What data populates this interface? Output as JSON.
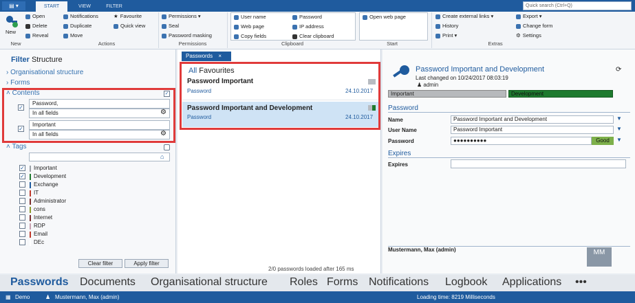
{
  "app": {
    "menu_label": "▤ ▾",
    "tabs": [
      "START",
      "VIEW",
      "FILTER"
    ],
    "search_placeholder": "Quick search (Ctrl+Q)"
  },
  "ribbon": {
    "new_label": "New",
    "new_items": [
      "Open",
      "Delete",
      "Reveal"
    ],
    "actions_items": [
      "Notifications",
      "Duplicate",
      "Move",
      "Favourite",
      "Quick view"
    ],
    "permissions_items": [
      "Permissions ▾",
      "Seal",
      "Password masking"
    ],
    "clipboard_items": [
      "User name",
      "Web page",
      "Copy fields",
      "Password",
      "IP address",
      "Clear clipboard"
    ],
    "start_items": [
      "Open web page"
    ],
    "extras_items": [
      "Create external links ▾",
      "History",
      "Print ▾",
      "Export ▾",
      "Change form",
      "Settings"
    ],
    "groups": [
      "New",
      "Actions",
      "Permissions",
      "Clipboard",
      "Start",
      "Extras"
    ]
  },
  "filter": {
    "title_bold": "Filter",
    "title_rest": "Structure",
    "sections": [
      "Organisational structure",
      "Forms",
      "Contents",
      "Tags"
    ],
    "content_filters": [
      {
        "value": "Password,",
        "scope": "In all fields"
      },
      {
        "value": "Important",
        "scope": "In all fields"
      }
    ],
    "tags": [
      {
        "name": "Important",
        "checked": true,
        "color": "#9aa0a6"
      },
      {
        "name": "Development",
        "checked": true,
        "color": "#1e7a2e"
      },
      {
        "name": "Exchange",
        "checked": false,
        "color": "#1f5b9e"
      },
      {
        "name": "IT",
        "checked": false,
        "color": "#c0392b"
      },
      {
        "name": "Administrator",
        "checked": false,
        "color": "#7b2d2d"
      },
      {
        "name": "cons",
        "checked": false,
        "color": "#8a9a2a"
      },
      {
        "name": "Internet",
        "checked": false,
        "color": "#7b2d2d"
      },
      {
        "name": "RDP",
        "checked": false,
        "color": "#c8a0b0"
      },
      {
        "name": "Email",
        "checked": false,
        "color": "#c0392b"
      },
      {
        "name": "DEc",
        "checked": false,
        "color": "#ffffff"
      }
    ],
    "clear_label": "Clear filter",
    "apply_label": "Apply filter"
  },
  "list": {
    "tab_label": "Passwords",
    "tab_close": "×",
    "header_all": "All",
    "header_fav": "Favourites",
    "items": [
      {
        "title": "Password Important",
        "type": "Password",
        "date": "24.10.2017"
      },
      {
        "title": "Password Important and Development",
        "type": "Password",
        "date": "24.10.2017"
      }
    ],
    "footer": "2/0 passwords loaded after 165 ms"
  },
  "detail": {
    "title": "Password Important and Development",
    "changed": "Last changed on 10/24/2017 08:03:19",
    "user": "admin",
    "tags": [
      "Important",
      "Development"
    ],
    "section_password": "Password",
    "labels": [
      "Name",
      "User Name",
      "Password"
    ],
    "values": [
      "Password Important and Development",
      "Password Important",
      "●●●●●●●●●●"
    ],
    "strength": "Good",
    "section_expires": "Expires",
    "expires_label": "Expires",
    "expires_value": "",
    "owner": "Mustermann, Max (admin)",
    "badge": "MM"
  },
  "nav": [
    "Passwords",
    "Documents",
    "Organisational structure",
    "Roles",
    "Forms",
    "Notifications",
    "Logbook",
    "Applications",
    "•••"
  ],
  "status": {
    "db": "Demo",
    "user": "Mustermann, Max (admin)",
    "loading": "Loading time: 8219 Milliseconds"
  },
  "colors": {
    "accent": "#1f5b9e",
    "highlight": "#e03a3a",
    "selected": "#cfe3f5",
    "strength": "#7db04a"
  }
}
